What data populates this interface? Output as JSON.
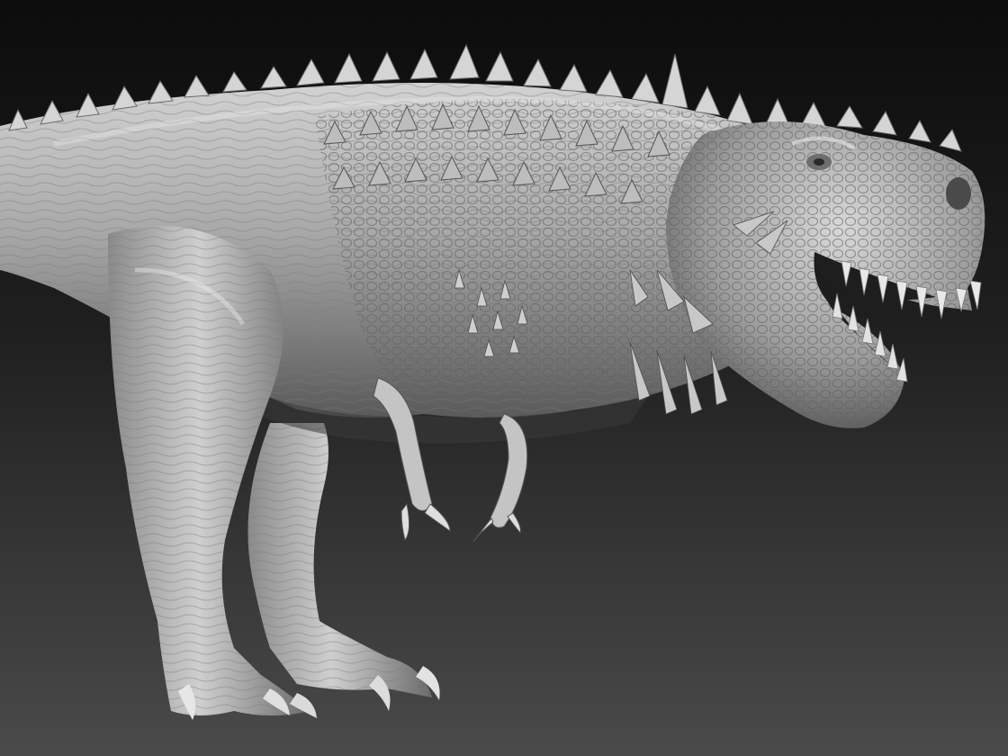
{
  "scene": {
    "subject": "sculpted-tyrannosaurus",
    "render_style": "grey-clay",
    "colors": {
      "background_top": "#0c0c0c",
      "background_bottom": "#4a4a4a",
      "clay_highlight": "#d9d9d9",
      "clay_mid": "#a2a2a2",
      "clay_shadow": "#4c4c4c",
      "clay_dark": "#262626"
    },
    "icons": {
      "spike": "spike-icon",
      "tooth": "tooth-icon",
      "claw": "claw-icon",
      "eye": "eye-icon"
    }
  }
}
